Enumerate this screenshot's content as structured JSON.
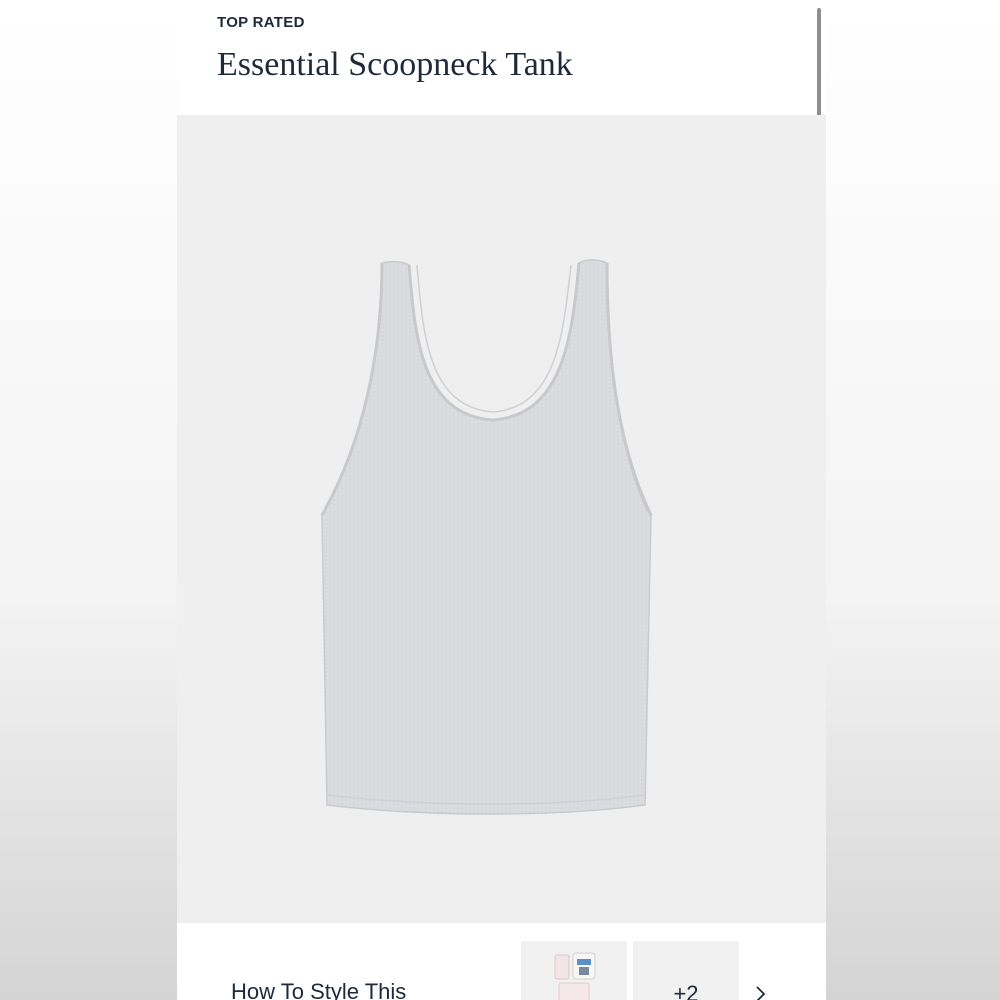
{
  "product": {
    "badge": "TOP RATED",
    "title": "Essential Scoopneck Tank"
  },
  "style_section": {
    "label": "How To Style This",
    "more_count": "+2",
    "next_icon": "chevron-right-icon"
  },
  "colors": {
    "text": "#1e2a3a",
    "product_bg": "#efefef",
    "tank_gray": "#dcdde0"
  }
}
